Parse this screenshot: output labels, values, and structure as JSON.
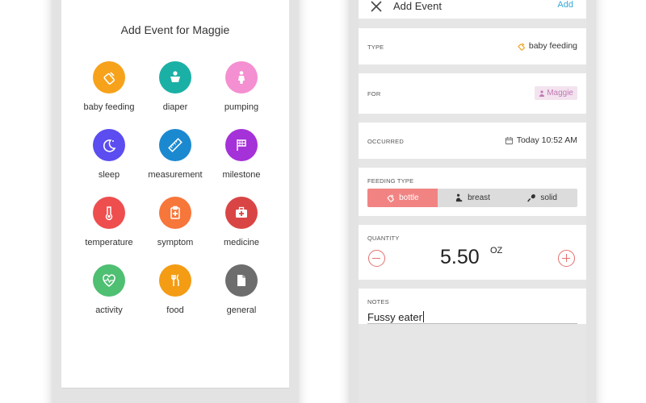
{
  "add_event_screen": {
    "title": "Add Event for Maggie",
    "categories": [
      {
        "label": "baby feeding",
        "icon": "bottle-icon",
        "color": "#f7a21b"
      },
      {
        "label": "diaper",
        "icon": "diaper-baby-icon",
        "color": "#1bb0a5"
      },
      {
        "label": "pumping",
        "icon": "pumping-mother-icon",
        "color": "#f48fd1"
      },
      {
        "label": "sleep",
        "icon": "moon-stars-icon",
        "color": "#5b4df0"
      },
      {
        "label": "measurement",
        "icon": "ruler-icon",
        "color": "#1b89d0"
      },
      {
        "label": "milestone",
        "icon": "flag-icon",
        "color": "#a531d8"
      },
      {
        "label": "temperature",
        "icon": "thermometer-icon",
        "color": "#ee4e4e"
      },
      {
        "label": "symptom",
        "icon": "clipboard-plus-icon",
        "color": "#f7763a"
      },
      {
        "label": "medicine",
        "icon": "medical-kit-icon",
        "color": "#d94545"
      },
      {
        "label": "activity",
        "icon": "heartbeat-icon",
        "color": "#4fbf72"
      },
      {
        "label": "food",
        "icon": "fork-knife-icon",
        "color": "#f39c14"
      },
      {
        "label": "general",
        "icon": "document-icon",
        "color": "#6d6d6d"
      }
    ]
  },
  "event_form": {
    "nav": {
      "title": "Add Event",
      "add_label": "Add"
    },
    "type": {
      "label": "TYPE",
      "value": "baby feeding"
    },
    "for": {
      "label": "FOR",
      "value": "Maggie"
    },
    "occurred": {
      "label": "OCCURRED",
      "value": "Today 10:52 AM"
    },
    "feeding_type": {
      "label": "FEEDING TYPE",
      "options": [
        "bottle",
        "breast",
        "solid"
      ],
      "selected": "bottle"
    },
    "quantity": {
      "label": "QUANTITY",
      "value": "5.50",
      "unit": "OZ"
    },
    "notes": {
      "label": "NOTES",
      "value": "Fussy eater"
    }
  },
  "colors": {
    "accent_red": "#f28383",
    "add_blue": "#34a8d6",
    "maggie_chip_bg": "#f3e3ef",
    "maggie_chip_text": "#c07ab4"
  }
}
